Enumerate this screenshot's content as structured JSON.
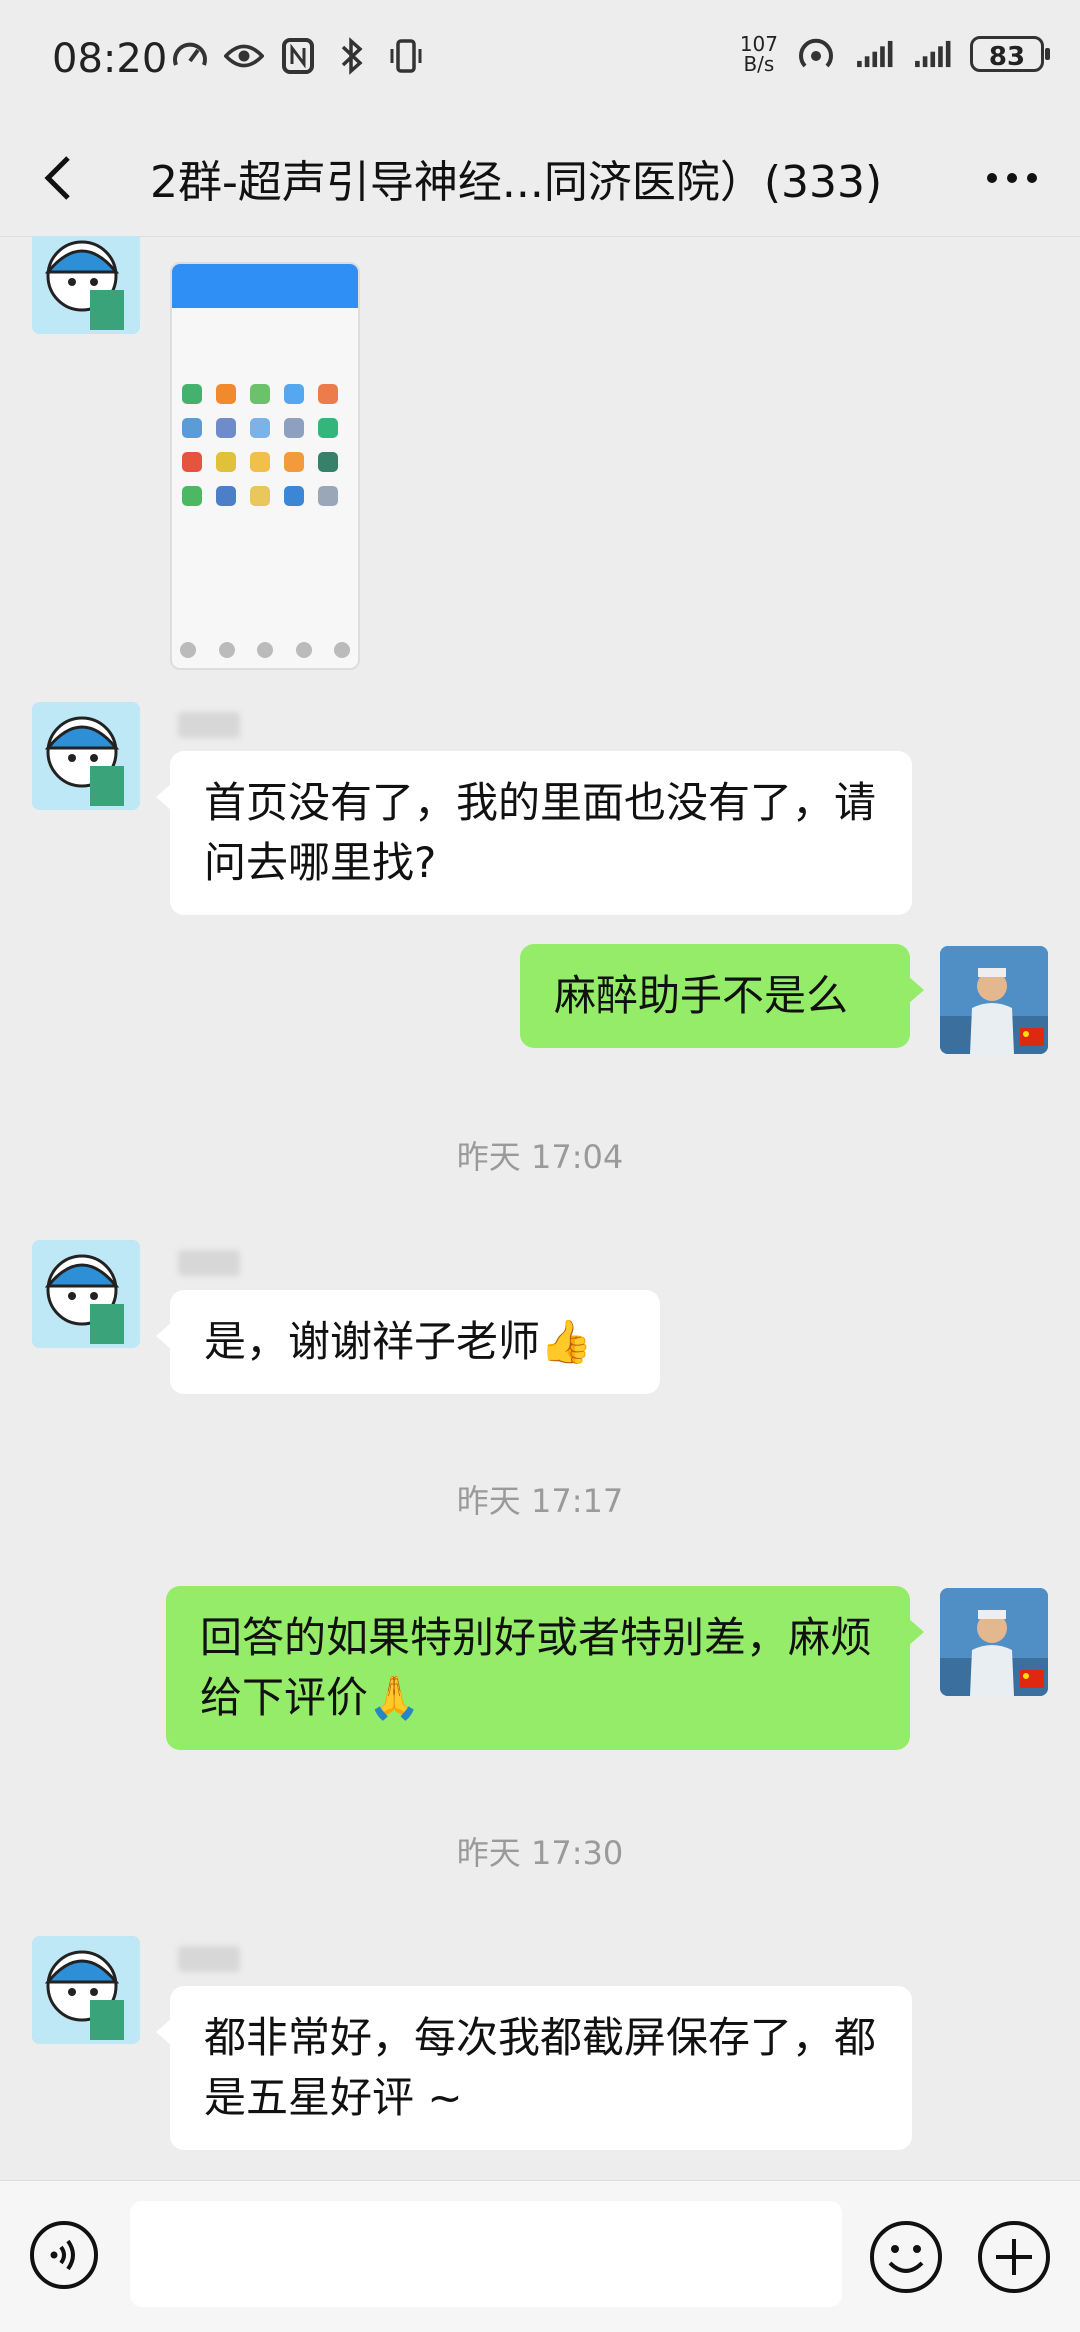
{
  "status_bar": {
    "time": "08:20",
    "net_speed_value": "107",
    "net_speed_unit": "B/s",
    "battery": "83"
  },
  "header": {
    "title": "2群-超声引导神经...同济医院）(333)"
  },
  "messages": [
    {
      "type": "image",
      "side": "left"
    },
    {
      "type": "text",
      "side": "left",
      "text": "首页没有了，我的里面也没有了，请问去哪里找?"
    },
    {
      "type": "text",
      "side": "right",
      "text": "麻醉助手不是么"
    },
    {
      "type": "time",
      "text": "昨天 17:04"
    },
    {
      "type": "text",
      "side": "left",
      "text": "是，谢谢祥子老师👍"
    },
    {
      "type": "time",
      "text": "昨天 17:17"
    },
    {
      "type": "text",
      "side": "right",
      "text": "回答的如果特别好或者特别差，麻烦给下评价🙏"
    },
    {
      "type": "time",
      "text": "昨天 17:30"
    },
    {
      "type": "text",
      "side": "left",
      "text": "都非常好，每次我都截屏保存了，都是五星好评 ~"
    }
  ],
  "input_bar": {
    "placeholder": ""
  },
  "colors": {
    "background": "#ededed",
    "outgoing_bubble": "#95ec69",
    "incoming_bubble": "#ffffff"
  }
}
